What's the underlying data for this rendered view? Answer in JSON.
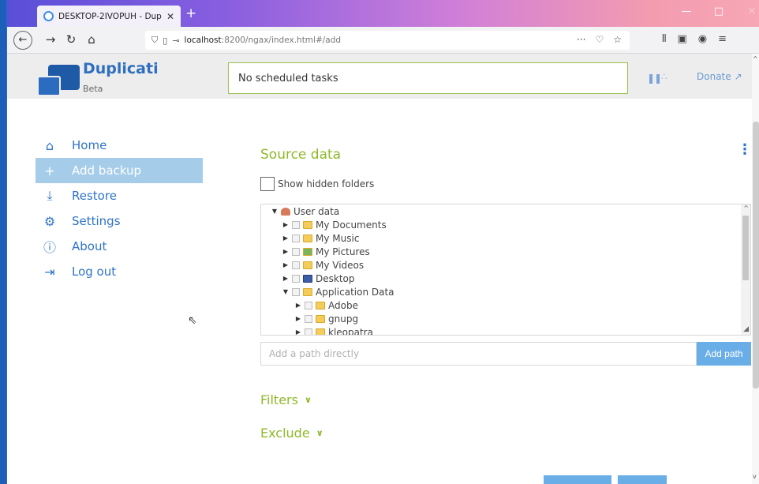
{
  "browser": {
    "tab_title": "DESKTOP-2IVOPUH - Duplicati",
    "tab_close": "✕",
    "new_tab": "+",
    "url_host": "localhost",
    "url_path": ":8200/ngax/index.html#/add",
    "window_controls": {
      "minimize": "—",
      "maximize": "□",
      "close": "✕"
    }
  },
  "header": {
    "app_name": "Duplicati",
    "app_tag": "Beta",
    "status_text": "No scheduled tasks",
    "donate_label": "Donate"
  },
  "menu": {
    "items": [
      {
        "label": "Home",
        "icon": "home-icon",
        "active": false
      },
      {
        "label": "Add backup",
        "icon": "plus-icon",
        "active": true
      },
      {
        "label": "Restore",
        "icon": "restore-icon",
        "active": false
      },
      {
        "label": "Settings",
        "icon": "gear-icon",
        "active": false
      },
      {
        "label": "About",
        "icon": "info-icon",
        "active": false
      },
      {
        "label": "Log out",
        "icon": "logout-icon",
        "active": false
      }
    ]
  },
  "source": {
    "title": "Source data",
    "show_hidden_label": "Show hidden folders",
    "tree": [
      {
        "label": "User data",
        "level": 0,
        "expanded": true,
        "icon": "user",
        "checkbox": false
      },
      {
        "label": "My Documents",
        "level": 1,
        "expanded": false,
        "icon": "folder",
        "checkbox": true
      },
      {
        "label": "My Music",
        "level": 1,
        "expanded": false,
        "icon": "music",
        "checkbox": true
      },
      {
        "label": "My Pictures",
        "level": 1,
        "expanded": false,
        "icon": "pictures",
        "checkbox": true
      },
      {
        "label": "My Videos",
        "level": 1,
        "expanded": false,
        "icon": "folder",
        "checkbox": true
      },
      {
        "label": "Desktop",
        "level": 1,
        "expanded": false,
        "icon": "desktop",
        "checkbox": true
      },
      {
        "label": "Application Data",
        "level": 1,
        "expanded": true,
        "icon": "folder",
        "checkbox": true
      },
      {
        "label": "Adobe",
        "level": 2,
        "expanded": false,
        "icon": "folder",
        "checkbox": true
      },
      {
        "label": "gnupg",
        "level": 2,
        "expanded": false,
        "icon": "folder",
        "checkbox": true
      },
      {
        "label": "kleopatra",
        "level": 2,
        "expanded": false,
        "icon": "folder",
        "checkbox": true
      }
    ],
    "path_placeholder": "Add a path directly",
    "add_path_label": "Add path"
  },
  "filters_label": "Filters",
  "exclude_label": "Exclude",
  "colors": {
    "accent_green": "#8fb82a",
    "accent_blue": "#2f74c8",
    "active_menu_bg": "#a5cdea"
  }
}
